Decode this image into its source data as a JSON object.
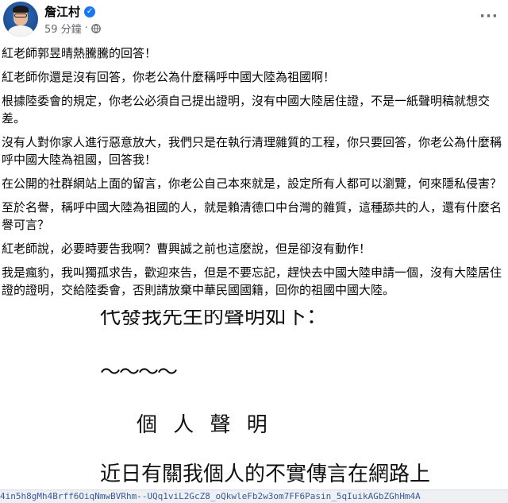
{
  "post": {
    "author": "詹江村",
    "time": "59 分鐘",
    "more_label": "···",
    "paragraphs": [
      "紅老師郭昱晴熱騰騰的回答！",
      "紅老師你還是沒有回答，你老公為什麼稱呼中國大陸為祖國啊！",
      "根據陸委會的規定，你老公必須自己提出證明，沒有中國大陸居住證，不是一紙聲明稿就想交差。",
      "沒有人對你家人進行惡意放大，我們只是在執行清理雜質的工程，你只要回答，你老公為什麼稱呼中國大陸為祖國，回答我！",
      "在公開的社群網站上面的留言，你老公自己本來就是，設定所有人都可以瀏覽，何來隱私侵害？",
      "至於名譽，稱呼中國大陸為祖國的人，就是賴清德口中台灣的雜質，這種舔共的人，還有什麼名譽可言？",
      "紅老師說，必要時要告我啊？曹興誠之前也這麼說，但是卻沒有動作！",
      "我是瘋豹，我叫獨孤求告，歡迎來告，但是不要忘記，趕快去中國大陸申請一個，沒有大陸居住證的證明，交給陸委會，否則請放棄中華民國國籍，回你的祖國中國大陸。"
    ]
  },
  "image": {
    "line1": "代發我先生的聲明如下：",
    "line2": "〜〜〜〜",
    "line3": "個 人 聲 明",
    "line4": "近日有關我個人的不實傳言在網路上"
  },
  "status_url": "4in5h8gMh4Brff6OiqNmwBVRhm--UQq1viL2GcZ8_oQkwleFb2w3om7FF6Pasin_5qIuikAGbZGhHm4A",
  "colors": {
    "verified": "#1877f2",
    "meta": "#65676b",
    "text": "#050505"
  },
  "icons": {
    "verified": "verified-badge-icon",
    "audience": "globe-icon",
    "more": "more-options-icon"
  }
}
